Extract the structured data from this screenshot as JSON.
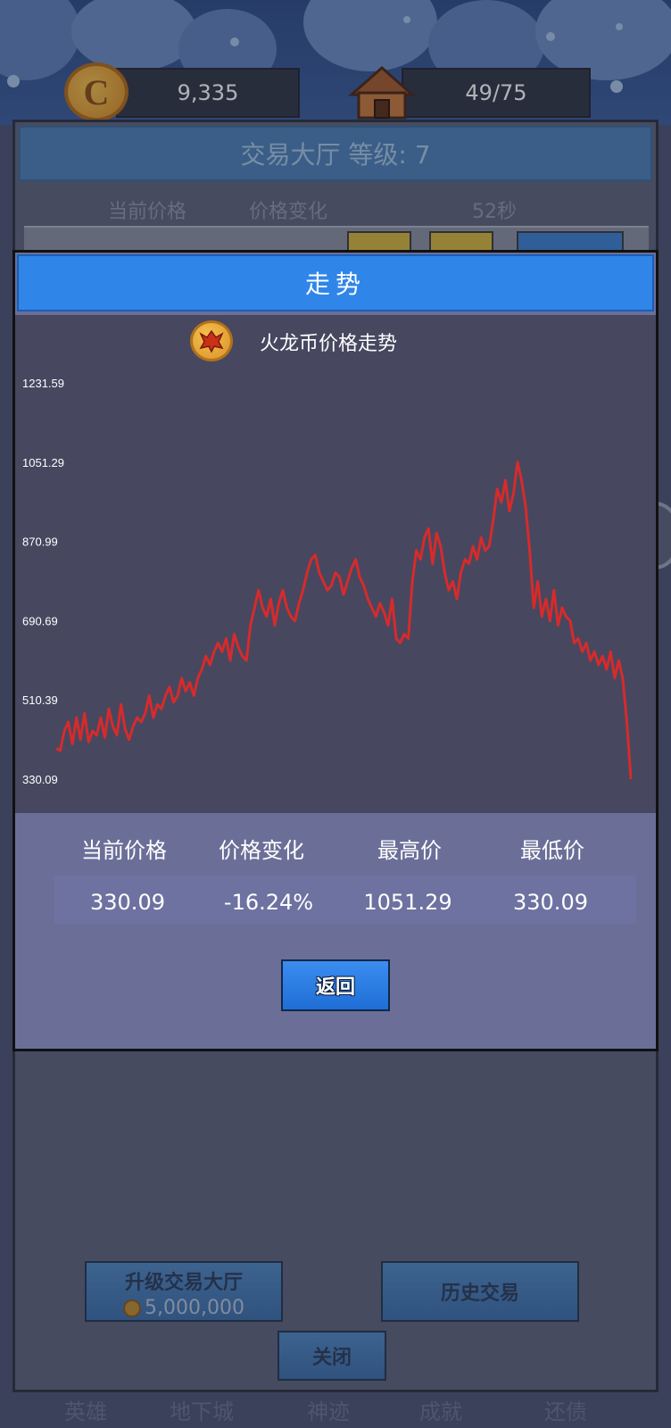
{
  "resources": {
    "coin_amount": "9,335",
    "coin_icon_glyph": "C",
    "population": "49/75"
  },
  "hall": {
    "title": "交易大厅 等级: 7",
    "headers": {
      "current_price": "当前价格",
      "price_change": "价格变化",
      "countdown": "52秒"
    },
    "upgrade_label": "升级交易大厅",
    "upgrade_cost": "5,000,000",
    "history_label": "历史交易",
    "close_label": "关闭"
  },
  "bottom_nav": [
    "英雄",
    "地下城",
    "神迹",
    "成就",
    "还债"
  ],
  "modal": {
    "header": "走势",
    "chart_title": "火龙币价格走势",
    "stats": {
      "labels": [
        "当前价格",
        "价格变化",
        "最高价",
        "最低价"
      ],
      "values": [
        "330.09",
        "-16.24%",
        "1051.29",
        "330.09"
      ]
    },
    "back_label": "返回"
  },
  "colors": {
    "line": "#d62b2b",
    "chart_bg": "#474760",
    "modal_header": "#2f86e8"
  },
  "chart_data": {
    "type": "line",
    "title": "火龙币价格走势",
    "ylim": [
      330.09,
      1231.59
    ],
    "yticks": [
      "1231.59",
      "1051.29",
      "870.99",
      "690.69",
      "510.39",
      "330.09"
    ],
    "values": [
      400,
      395,
      440,
      460,
      410,
      470,
      420,
      480,
      415,
      440,
      430,
      470,
      425,
      490,
      450,
      430,
      500,
      445,
      420,
      450,
      470,
      460,
      480,
      520,
      470,
      500,
      490,
      520,
      540,
      505,
      520,
      560,
      530,
      550,
      520,
      560,
      580,
      610,
      590,
      620,
      640,
      620,
      650,
      600,
      660,
      630,
      610,
      600,
      680,
      720,
      760,
      720,
      700,
      740,
      680,
      730,
      760,
      720,
      700,
      690,
      730,
      760,
      800,
      830,
      840,
      800,
      780,
      760,
      770,
      800,
      790,
      750,
      780,
      810,
      830,
      790,
      770,
      740,
      720,
      700,
      730,
      710,
      680,
      740,
      650,
      640,
      660,
      650,
      780,
      850,
      830,
      880,
      900,
      820,
      890,
      860,
      800,
      760,
      780,
      740,
      800,
      830,
      820,
      860,
      830,
      880,
      850,
      860,
      920,
      990,
      960,
      1010,
      940,
      980,
      1051.29,
      1010,
      950,
      850,
      720,
      780,
      700,
      740,
      690,
      760,
      680,
      720,
      700,
      690,
      640,
      650,
      620,
      640,
      600,
      620,
      590,
      610,
      580,
      620,
      560,
      600,
      560,
      460,
      330.09
    ]
  }
}
